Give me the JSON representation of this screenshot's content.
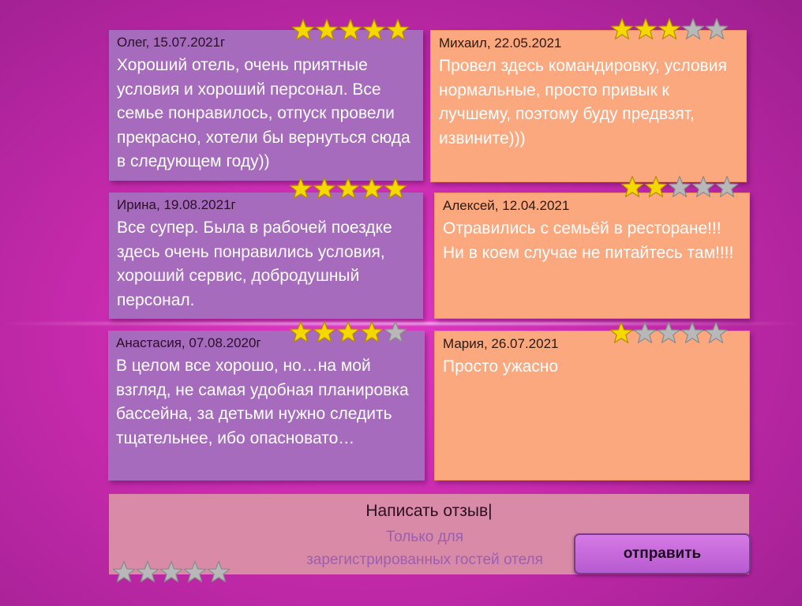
{
  "colors": {
    "star_filled": "#f5d800",
    "star_empty": "#b8b8b8",
    "card_purple": "#a66bbd",
    "card_orange": "#fba87f"
  },
  "reviews": [
    {
      "author": "Олег, 15.07.2021г",
      "rating": 5,
      "text": "Хороший отель, очень приятные условия и хороший персонал. Все семье понравилось, отпуск провели прекрасно, хотели бы вернуться сюда в следующем году))"
    },
    {
      "author": "Михаил, 22.05.2021",
      "rating": 3,
      "text": "Провел здесь командировку, условия нормальные, просто привык к лучшему, поэтому буду предвзят, извините)))"
    },
    {
      "author": "Ирина, 19.08.2021г",
      "rating": 5,
      "text": "Все супер. Была в рабочей поездке здесь очень понравились условия, хороший сервис, добродушный персонал."
    },
    {
      "author": "Алексей, 12.04.2021",
      "rating": 2,
      "text": "Отравились с семьёй в ресторане!!! Ни в коем случае не питайтесь там!!!!"
    },
    {
      "author": "Анастасия, 07.08.2020г",
      "rating": 4,
      "text": "В целом все хорошо, но…на мой взгляд, не самая удобная планировка бассейна, за детьми нужно следить тщательнее, ибо опасновато…"
    },
    {
      "author": "Мария, 26.07.2021",
      "rating": 1,
      "text": "Просто ужасно"
    }
  ],
  "form": {
    "title": "Написать отзыв|",
    "note_line1": "Только для",
    "note_line2": "зарегистрированных гостей отеля",
    "rating": 0,
    "send_label": "отправить"
  }
}
